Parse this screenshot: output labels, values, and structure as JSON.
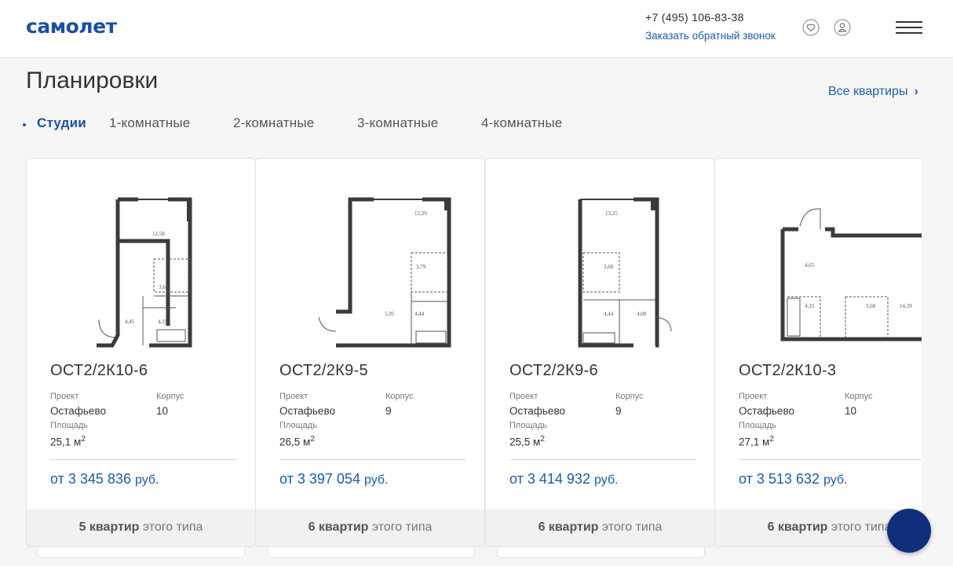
{
  "header": {
    "logo": "самолет",
    "phone": "+7 (495) 106-83-38",
    "callback": "Заказать обратный звонок",
    "icons": [
      "heart-icon",
      "user-icon",
      "menu-icon"
    ]
  },
  "section": {
    "title": "Планировки",
    "all_link": "Все квартиры",
    "tabs": [
      {
        "label": "Студии",
        "active": true
      },
      {
        "label": "1-комнатные",
        "active": false
      },
      {
        "label": "2-комнатные",
        "active": false
      },
      {
        "label": "3-комнатные",
        "active": false
      },
      {
        "label": "4-комнатные",
        "active": false
      }
    ]
  },
  "card_labels": {
    "project": "Проект",
    "building": "Корпус",
    "area": "Площадь",
    "price_prefix": "от",
    "currency": "руб.",
    "unit": "м",
    "unit_power": "2",
    "foot_suffix": "этого типа"
  },
  "cards": [
    {
      "code": "ОСТ2/2К10-6",
      "project": "Остафьево",
      "building": "10",
      "area": "25,1",
      "price": "3 345 836",
      "count": "5 квартир",
      "plan_labels": [
        "12,58",
        "3,68",
        "4,45",
        "4,35"
      ]
    },
    {
      "code": "ОСТ2/2К9-5",
      "project": "Остафьево",
      "building": "9",
      "area": "26,5",
      "price": "3 397 054",
      "count": "6 квартир",
      "plan_labels": [
        "12,29",
        "3,79",
        "5,95",
        "4,44"
      ]
    },
    {
      "code": "ОСТ2/2К9-6",
      "project": "Остафьево",
      "building": "9",
      "area": "25,5",
      "price": "3 414 932",
      "count": "6 квартир",
      "plan_labels": [
        "13,25",
        "3,68",
        "4,44",
        "4,08"
      ]
    },
    {
      "code": "ОСТ2/2К10-3",
      "project": "Остафьево",
      "building": "10",
      "area": "27,1",
      "price": "3 513 632",
      "count": "6 квартир",
      "plan_labels": [
        "4,65",
        "4,35",
        "3,68",
        "14,39"
      ]
    }
  ],
  "colors": {
    "brand": "#1d4fa0",
    "link": "#1d5ba8",
    "fab": "#0f2f7a"
  }
}
